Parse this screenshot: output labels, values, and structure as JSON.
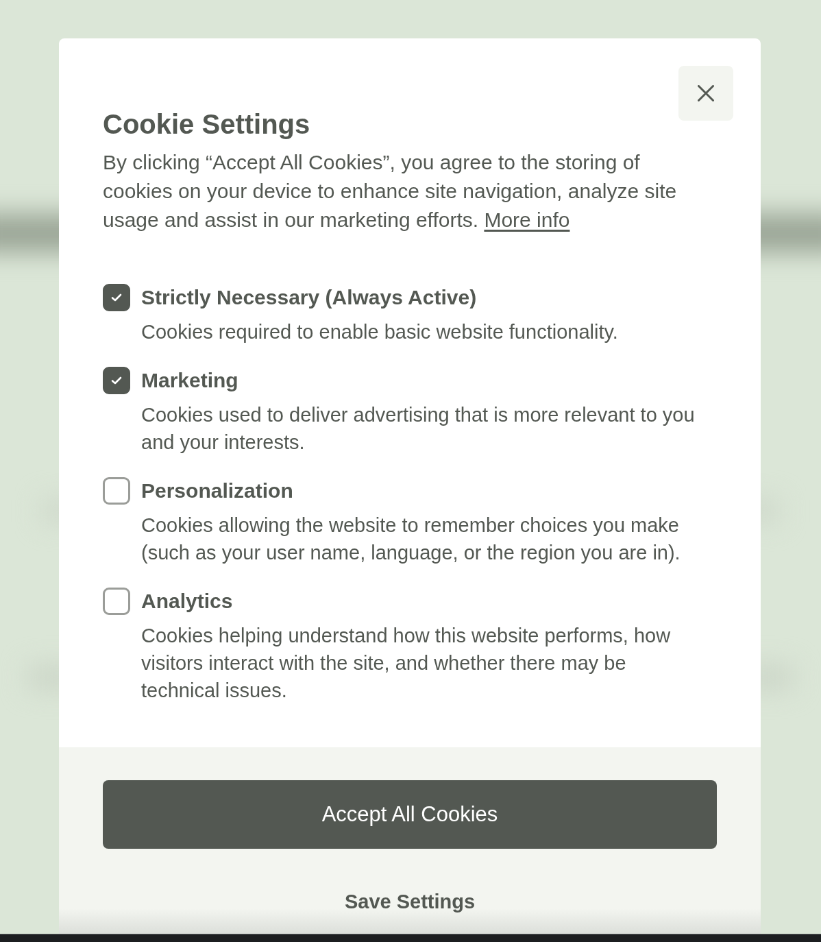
{
  "dialog": {
    "title": "Cookie Settings",
    "intro": {
      "text": "By clicking “Accept All Cookies”, you agree to the storing of cookies on your device to enhance site navigation, analyze site usage and assist in our marketing efforts.",
      "link": "More info"
    },
    "options": [
      {
        "label": "Strictly Necessary (Always Active)",
        "description": "Cookies required to enable basic website functionality.",
        "checked": true
      },
      {
        "label": "Marketing",
        "description": "Cookies used to deliver advertising that is more relevant to you and your interests.",
        "checked": true
      },
      {
        "label": "Personalization",
        "description": "Cookies allowing the website to remember choices you make (such as your user name, language, or the region you are in).",
        "checked": false
      },
      {
        "label": "Analytics",
        "description": "Cookies helping understand how this website performs, how visitors interact with the site, and whether there may be technical issues.",
        "checked": false
      }
    ],
    "buttons": [
      {
        "label": "Accept All Cookies",
        "kind": "primary"
      },
      {
        "label": "Save Settings",
        "kind": "text"
      }
    ]
  }
}
